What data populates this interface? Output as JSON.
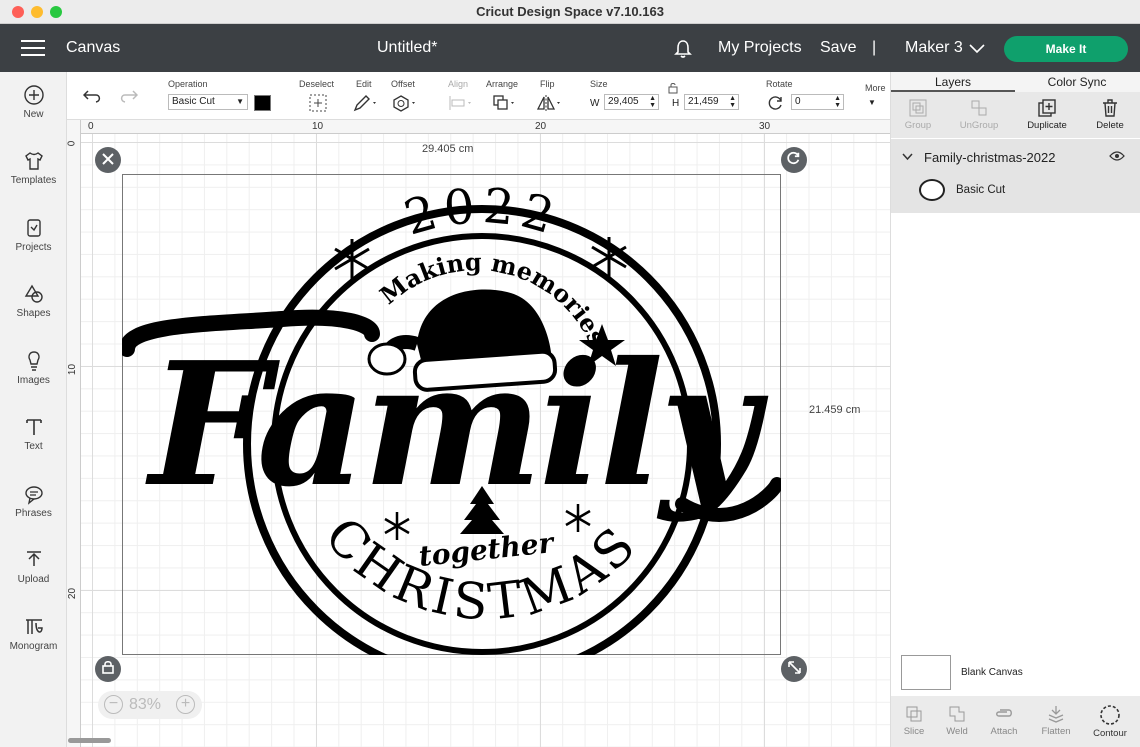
{
  "window": {
    "title": "Cricut Design Space  v7.10.163"
  },
  "appbar": {
    "section": "Canvas",
    "doc_title": "Untitled*",
    "my_projects": "My Projects",
    "save": "Save",
    "separator": "|",
    "machine": "Maker 3",
    "make_it": "Make It"
  },
  "sidebar": {
    "items": [
      {
        "label": "New",
        "icon": "plus-circle-icon"
      },
      {
        "label": "Templates",
        "icon": "shirt-icon"
      },
      {
        "label": "Projects",
        "icon": "projects-icon"
      },
      {
        "label": "Shapes",
        "icon": "shapes-icon"
      },
      {
        "label": "Images",
        "icon": "lightbulb-icon"
      },
      {
        "label": "Text",
        "icon": "text-icon"
      },
      {
        "label": "Phrases",
        "icon": "speech-bubble-icon"
      },
      {
        "label": "Upload",
        "icon": "upload-icon"
      },
      {
        "label": "Monogram",
        "icon": "monogram-icon"
      }
    ]
  },
  "toolbar": {
    "operation_label": "Operation",
    "operation_value": "Basic Cut",
    "deselect": "Deselect",
    "edit": "Edit",
    "offset": "Offset",
    "align": "Align",
    "arrange": "Arrange",
    "flip": "Flip",
    "size": "Size",
    "w_label": "W",
    "w_value": "29,405",
    "h_label": "H",
    "h_value": "21,459",
    "rotate": "Rotate",
    "rotate_value": "0",
    "more": "More"
  },
  "canvas": {
    "ruler_h": [
      "0",
      "10",
      "20",
      "30"
    ],
    "ruler_v": [
      "0",
      "10",
      "20"
    ],
    "width_label": "29.405 cm",
    "height_label": "21.459 cm",
    "zoom": "83%",
    "design_text": {
      "year": "2022",
      "top_arc": "Making memories",
      "main": "Family",
      "together": "together",
      "bottom_arc": "CHRISTMAS"
    }
  },
  "layers_panel": {
    "tabs": [
      "Layers",
      "Color Sync"
    ],
    "actions": [
      "Group",
      "UnGroup",
      "Duplicate",
      "Delete"
    ],
    "layer_group": "Family-christmas-2022",
    "layer_item": "Basic Cut",
    "blank_canvas": "Blank Canvas",
    "bottom_actions": [
      "Slice",
      "Weld",
      "Attach",
      "Flatten",
      "Contour"
    ]
  },
  "colors": {
    "appbar": "#3c4044",
    "make_it": "#0fa06c",
    "ink": "#000000"
  }
}
